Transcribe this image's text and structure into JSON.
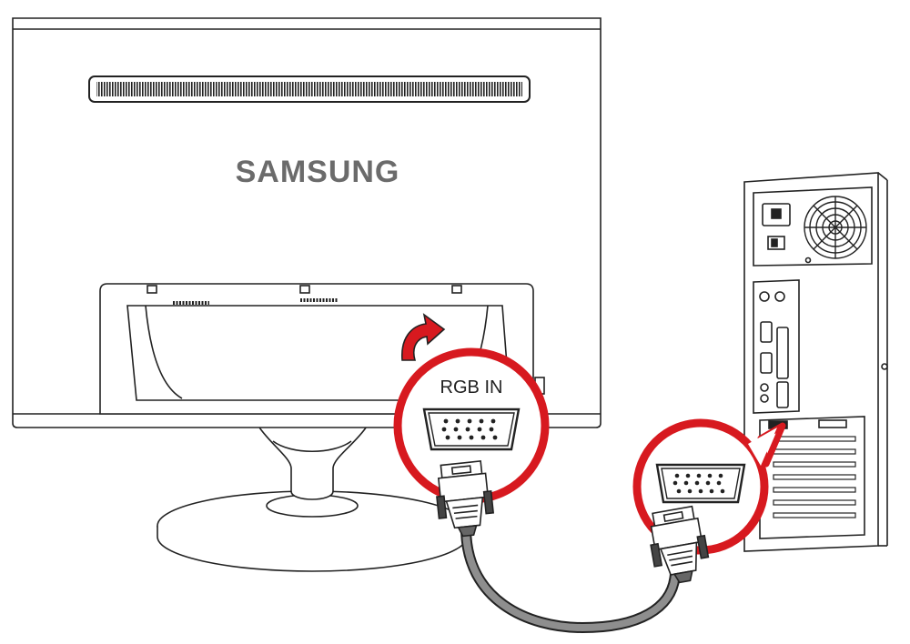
{
  "monitor": {
    "brand": "SAMSUNG"
  },
  "callout_monitor": {
    "port_label": "RGB IN"
  },
  "colors": {
    "accent_red": "#D7191F",
    "line": "#222222",
    "cable_gray": "#8E8E8E",
    "brand_gray": "#6B6B6B"
  },
  "icons": [
    "arrow-curved-up-icon",
    "vga-port-icon",
    "vga-connector-icon",
    "fan-grille-icon",
    "power-switch-icon"
  ]
}
